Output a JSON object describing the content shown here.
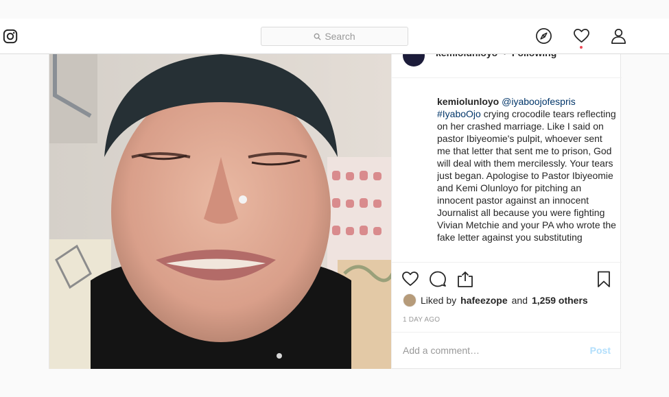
{
  "nav": {
    "logo_icon": "instagram-glyph-icon",
    "search_placeholder": "Search",
    "icons": [
      "compass-icon",
      "heart-icon",
      "profile-icon"
    ]
  },
  "post": {
    "author": "kemiolunloyo",
    "separator": "•",
    "follow_status": "Following",
    "caption": {
      "username": "kemiolunloyo",
      "mention": "@iyaboojofespris",
      "hashtag": "#IyaboOjo",
      "text": " crying crocodile tears reflecting on her crashed marriage. Like I said on pastor Ibiyeomie's pulpit, whoever sent me that letter that sent me to prison, God will deal with them mercilessly. Your tears just began. Apologise to Pastor Ibiyeomie and Kemi Olunloyo for pitching an innocent pastor against an innocent Journalist all because you were fighting Vivian Metchie and your PA who wrote the fake letter against you substituting"
    },
    "likes": {
      "prefix": "Liked by",
      "user": "hafeezope",
      "conjunction": "and",
      "others": "1,259 others"
    },
    "time_ago": "1 DAY AGO",
    "comment_placeholder": "Add a comment…",
    "post_label": "Post"
  },
  "colors": {
    "link": "#003569",
    "post_button": "#b2dffc",
    "notification_dot": "#ed4956"
  }
}
